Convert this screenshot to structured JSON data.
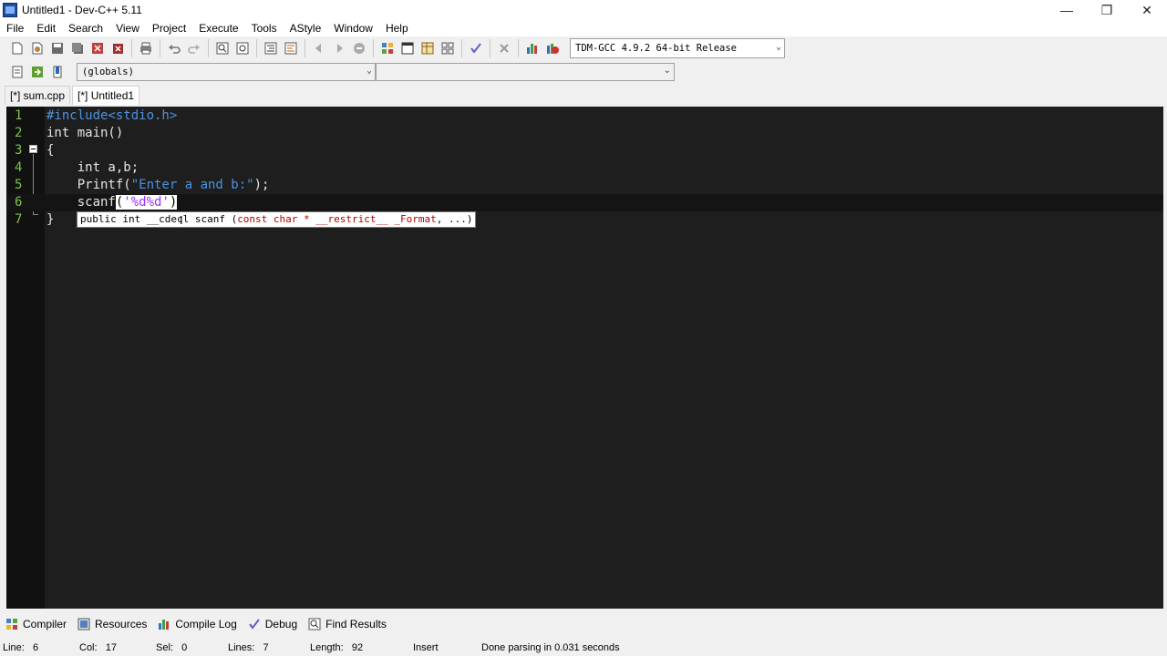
{
  "window": {
    "title": "Untitled1 - Dev-C++ 5.11",
    "minimize_glyph": "—",
    "restore_glyph": "❐",
    "close_glyph": "✕"
  },
  "menu": [
    "File",
    "Edit",
    "Search",
    "View",
    "Project",
    "Execute",
    "Tools",
    "AStyle",
    "Window",
    "Help"
  ],
  "toolbar": {
    "compiler": "TDM-GCC 4.9.2 64-bit Release"
  },
  "scope": {
    "globals": "(globals)"
  },
  "tabs": [
    "[*] sum.cpp",
    "[*] Untitled1"
  ],
  "editor": {
    "line_numbers": [
      "1",
      "2",
      "3",
      "4",
      "5",
      "6",
      "7"
    ],
    "lines": {
      "l1": "#include<stdio.h>",
      "l2": "int main()",
      "l3": "{",
      "l4": "    int a,b;",
      "l5_pre": "    Printf(",
      "l5_str": "\"Enter a and b:\"",
      "l5_post": ");",
      "l6_pre": "    scanf",
      "l6_open": "(",
      "l6_str": "'%d%d'",
      "l6_close": ")",
      "l7": "}"
    },
    "tooltip": {
      "part1": "public int __cdecl scanf (",
      "part2": "const char * __restrict__ _Format",
      "part3": ", ...)"
    }
  },
  "bottom_tabs": [
    "Compiler",
    "Resources",
    "Compile Log",
    "Debug",
    "Find Results"
  ],
  "status": {
    "line": "Line:   6",
    "col": "Col:   17",
    "sel": "Sel:   0",
    "lines": "Lines:   7",
    "length": "Length:   92",
    "mode": "Insert",
    "message": "Done parsing in 0.031 seconds"
  }
}
